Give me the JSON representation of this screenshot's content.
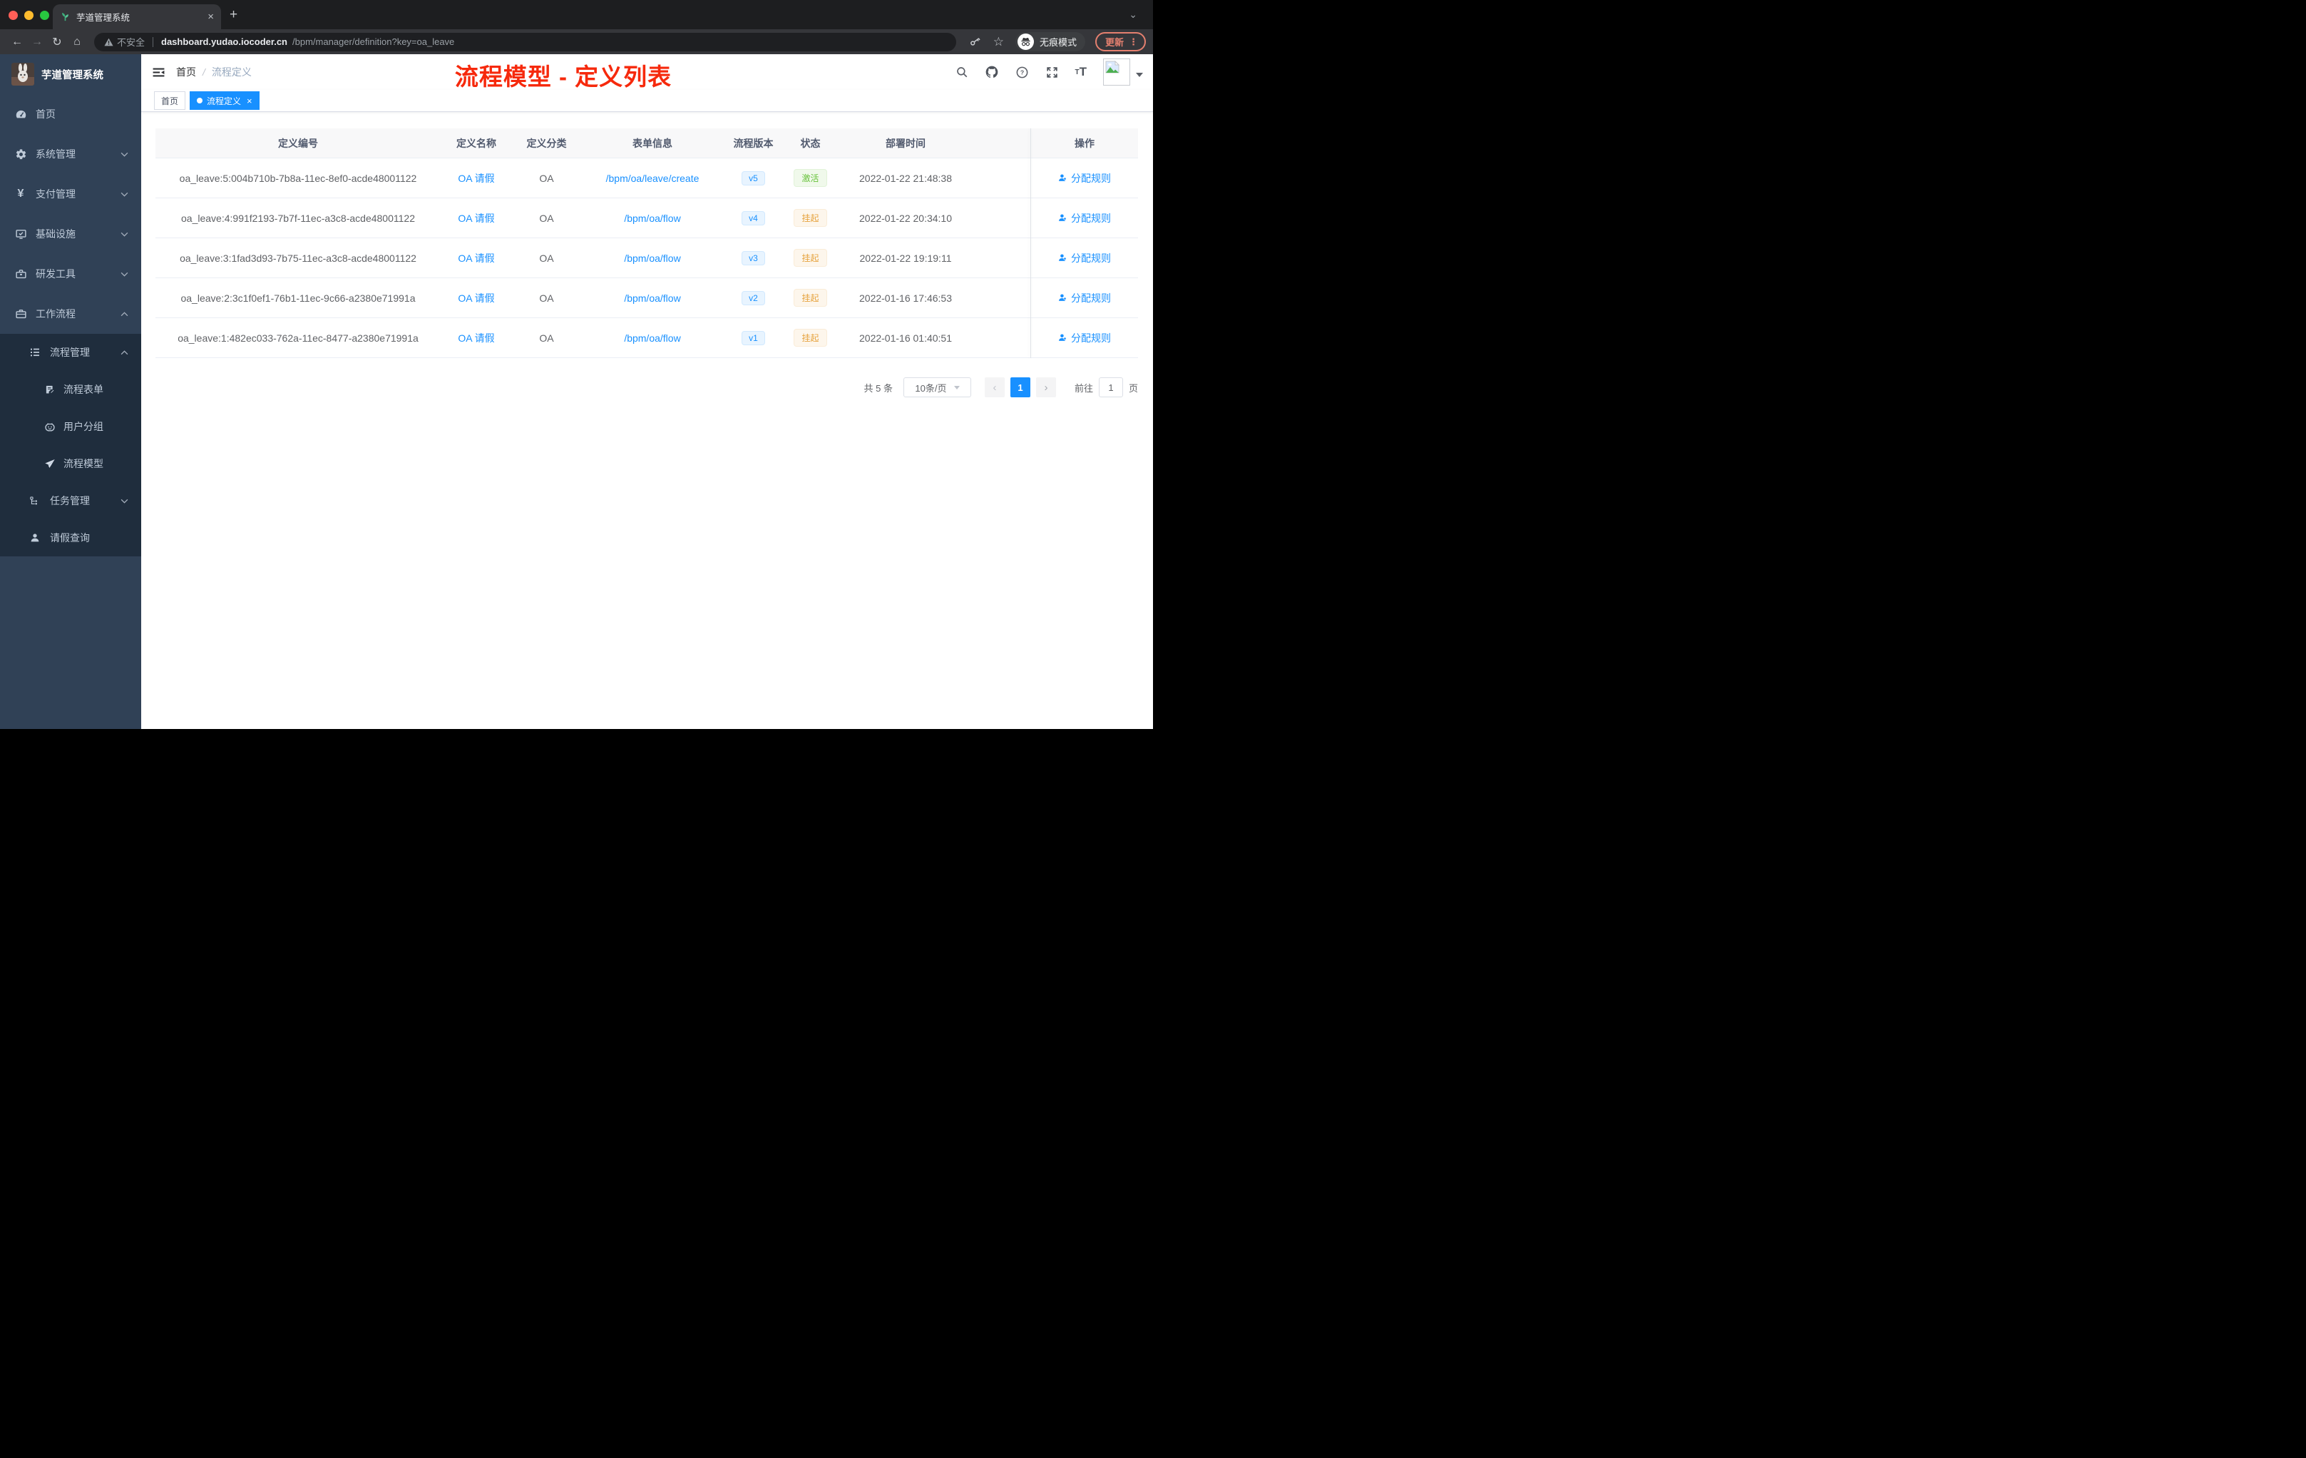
{
  "browser": {
    "tab_title": "芋道管理系统",
    "tab_close": "×",
    "new_tab": "+",
    "back": "←",
    "forward": "→",
    "reload": "↻",
    "home": "⌂",
    "security_warning": "不安全",
    "url_host": "dashboard.yudao.iocoder.cn",
    "url_path": "/bpm/manager/definition?key=oa_leave",
    "incognito_label": "无痕模式",
    "update_label": "更新",
    "menu_dots": "⋮",
    "tabstrip_caret": "⌄",
    "star": "☆"
  },
  "sidebar": {
    "logo_title": "芋道管理系统",
    "items": [
      {
        "label": "首页"
      },
      {
        "label": "系统管理"
      },
      {
        "label": "支付管理"
      },
      {
        "label": "基础设施"
      },
      {
        "label": "研发工具"
      },
      {
        "label": "工作流程"
      },
      {
        "label": "流程管理"
      },
      {
        "label": "流程表单"
      },
      {
        "label": "用户分组"
      },
      {
        "label": "流程模型"
      },
      {
        "label": "任务管理"
      },
      {
        "label": "请假查询"
      }
    ],
    "yen_icon": "¥"
  },
  "header": {
    "breadcrumb": [
      "首页",
      "流程定义"
    ],
    "breadcrumb_sep": "/",
    "annotation": "流程模型 - 定义列表"
  },
  "tags": {
    "home": "首页",
    "active": "流程定义",
    "close": "×"
  },
  "table": {
    "columns": [
      "定义编号",
      "定义名称",
      "定义分类",
      "表单信息",
      "流程版本",
      "状态",
      "部署时间",
      "操作"
    ],
    "action_label": "分配规则",
    "rows": [
      {
        "id": "oa_leave:5:004b710b-7b8a-11ec-8ef0-acde48001122",
        "name": "OA 请假",
        "category": "OA",
        "form": "/bpm/oa/leave/create",
        "version": "v5",
        "status": "激活",
        "time": "2022-01-22 21:48:38"
      },
      {
        "id": "oa_leave:4:991f2193-7b7f-11ec-a3c8-acde48001122",
        "name": "OA 请假",
        "category": "OA",
        "form": "/bpm/oa/flow",
        "version": "v4",
        "status": "挂起",
        "time": "2022-01-22 20:34:10"
      },
      {
        "id": "oa_leave:3:1fad3d93-7b75-11ec-a3c8-acde48001122",
        "name": "OA 请假",
        "category": "OA",
        "form": "/bpm/oa/flow",
        "version": "v3",
        "status": "挂起",
        "time": "2022-01-22 19:19:11"
      },
      {
        "id": "oa_leave:2:3c1f0ef1-76b1-11ec-9c66-a2380e71991a",
        "name": "OA 请假",
        "category": "OA",
        "form": "/bpm/oa/flow",
        "version": "v2",
        "status": "挂起",
        "time": "2022-01-16 17:46:53"
      },
      {
        "id": "oa_leave:1:482ec033-762a-11ec-8477-a2380e71991a",
        "name": "OA 请假",
        "category": "OA",
        "form": "/bpm/oa/flow",
        "version": "v1",
        "status": "挂起",
        "time": "2022-01-16 01:40:51"
      }
    ]
  },
  "pagination": {
    "total": "共 5 条",
    "page_size": "10条/页",
    "prev": "‹",
    "page": "1",
    "next": "›",
    "goto_prefix": "前往",
    "goto_value": "1",
    "goto_suffix": "页"
  },
  "colors": {
    "accent_blue": "#1890ff",
    "annotation_red": "#f6290c",
    "sidebar_bg": "#304156",
    "submenu_bg": "#1f2d3d",
    "menu_text": "#bfcbd9",
    "status_active_green": "#67c23a",
    "status_suspend_orange": "#e6a23c",
    "update_salmon": "#e5806f"
  }
}
